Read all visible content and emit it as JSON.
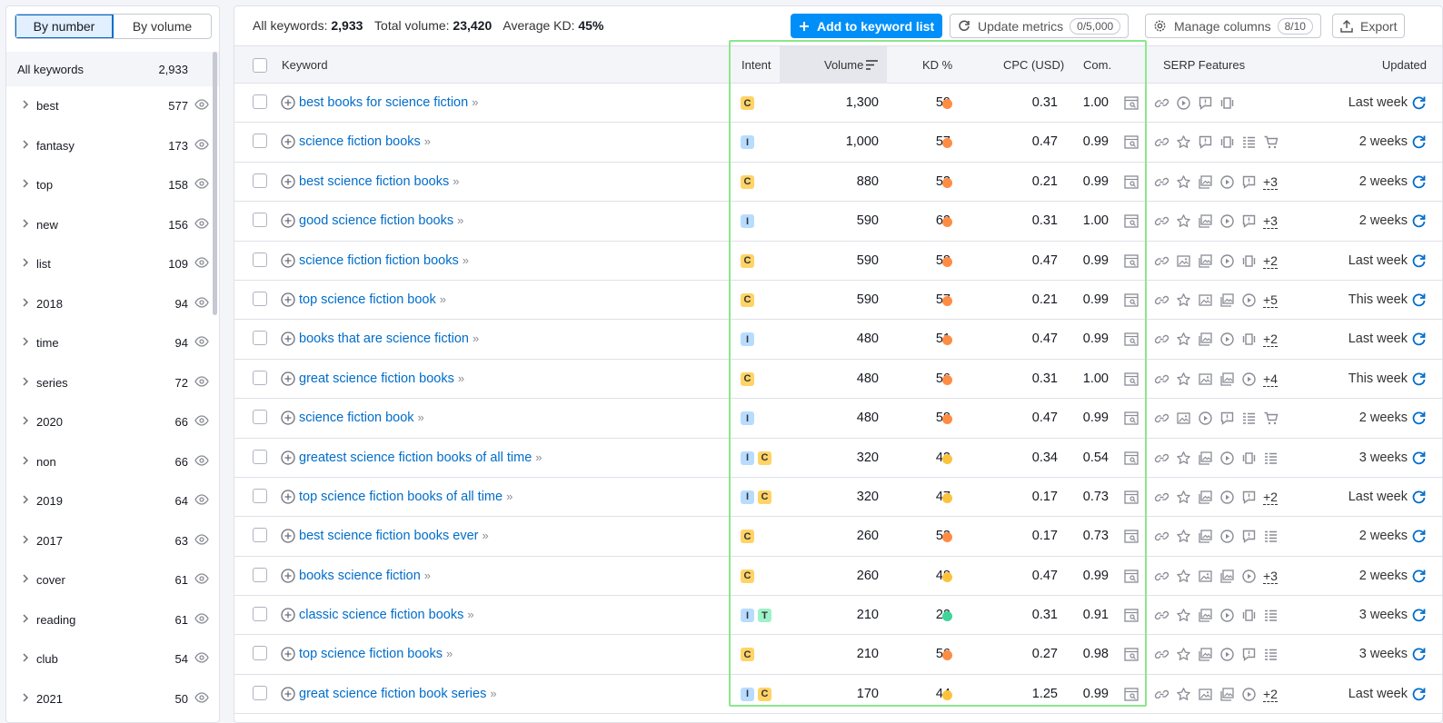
{
  "sidebar": {
    "toggle": [
      "By number",
      "By volume"
    ],
    "all_label": "All keywords",
    "all_count": "2,933",
    "items": [
      {
        "label": "best",
        "count": "577"
      },
      {
        "label": "fantasy",
        "count": "173"
      },
      {
        "label": "top",
        "count": "158"
      },
      {
        "label": "new",
        "count": "156"
      },
      {
        "label": "list",
        "count": "109"
      },
      {
        "label": "2018",
        "count": "94"
      },
      {
        "label": "time",
        "count": "94"
      },
      {
        "label": "series",
        "count": "72"
      },
      {
        "label": "2020",
        "count": "66"
      },
      {
        "label": "non",
        "count": "66"
      },
      {
        "label": "2019",
        "count": "64"
      },
      {
        "label": "2017",
        "count": "63"
      },
      {
        "label": "cover",
        "count": "61"
      },
      {
        "label": "reading",
        "count": "61"
      },
      {
        "label": "club",
        "count": "54"
      },
      {
        "label": "2021",
        "count": "50"
      }
    ]
  },
  "stats": {
    "all_label": "All keywords:",
    "all_value": "2,933",
    "volume_label": "Total volume:",
    "volume_value": "23,420",
    "kd_label": "Average KD:",
    "kd_value": "45%"
  },
  "toolbar": {
    "add_label": "Add to keyword list",
    "update_label": "Update metrics",
    "update_badge": "0/5,000",
    "columns_label": "Manage columns",
    "columns_badge": "8/10",
    "export_label": "Export"
  },
  "columns": {
    "keyword": "Keyword",
    "intent": "Intent",
    "volume": "Volume",
    "kd": "KD %",
    "cpc": "CPC (USD)",
    "com": "Com.",
    "serp": "SERP Features",
    "updated": "Updated"
  },
  "colors": {
    "hard": "#ff8c43",
    "medium": "#fdc23c",
    "easy": "#3fd49a",
    "link": "#006dca",
    "highlight": "#8be78b"
  },
  "rows": [
    {
      "keyword": "best books for science fiction",
      "intent": [
        "C"
      ],
      "volume": "1,300",
      "kd": "59",
      "kd_level": "hard",
      "cpc": "0.31",
      "com": "1.00",
      "features": [
        "link-icon",
        "video-icon",
        "review-icon",
        "carousel-icon"
      ],
      "more": "",
      "updated": "Last week"
    },
    {
      "keyword": "science fiction books",
      "intent": [
        "I"
      ],
      "volume": "1,000",
      "kd": "57",
      "kd_level": "hard",
      "cpc": "0.47",
      "com": "0.99",
      "features": [
        "link-icon",
        "star-icon",
        "review-icon",
        "carousel-icon",
        "list-icon",
        "cart-icon"
      ],
      "more": "",
      "updated": "2 weeks"
    },
    {
      "keyword": "best science fiction books",
      "intent": [
        "C"
      ],
      "volume": "880",
      "kd": "53",
      "kd_level": "hard",
      "cpc": "0.21",
      "com": "0.99",
      "features": [
        "link-icon",
        "star-icon",
        "images-icon",
        "video-icon",
        "review-icon"
      ],
      "more": "+3",
      "updated": "2 weeks"
    },
    {
      "keyword": "good science fiction books",
      "intent": [
        "I"
      ],
      "volume": "590",
      "kd": "62",
      "kd_level": "hard",
      "cpc": "0.31",
      "com": "1.00",
      "features": [
        "link-icon",
        "star-icon",
        "images-icon",
        "video-icon",
        "review-icon"
      ],
      "more": "+3",
      "updated": "2 weeks"
    },
    {
      "keyword": "science fiction fiction books",
      "intent": [
        "C"
      ],
      "volume": "590",
      "kd": "58",
      "kd_level": "hard",
      "cpc": "0.47",
      "com": "0.99",
      "features": [
        "link-icon",
        "image-icon",
        "images-icon",
        "video-icon",
        "carousel-icon"
      ],
      "more": "+2",
      "updated": "Last week"
    },
    {
      "keyword": "top science fiction book",
      "intent": [
        "C"
      ],
      "volume": "590",
      "kd": "57",
      "kd_level": "hard",
      "cpc": "0.21",
      "com": "0.99",
      "features": [
        "link-icon",
        "star-icon",
        "image-icon",
        "images-icon",
        "video-icon"
      ],
      "more": "+5",
      "updated": "This week"
    },
    {
      "keyword": "books that are science fiction",
      "intent": [
        "I"
      ],
      "volume": "480",
      "kd": "51",
      "kd_level": "hard",
      "cpc": "0.47",
      "com": "0.99",
      "features": [
        "link-icon",
        "star-icon",
        "images-icon",
        "video-icon",
        "carousel-icon"
      ],
      "more": "+2",
      "updated": "Last week"
    },
    {
      "keyword": "great science fiction books",
      "intent": [
        "C"
      ],
      "volume": "480",
      "kd": "56",
      "kd_level": "hard",
      "cpc": "0.31",
      "com": "1.00",
      "features": [
        "link-icon",
        "star-icon",
        "image-icon",
        "images-icon",
        "video-icon"
      ],
      "more": "+4",
      "updated": "This week"
    },
    {
      "keyword": "science fiction book",
      "intent": [
        "I"
      ],
      "volume": "480",
      "kd": "58",
      "kd_level": "hard",
      "cpc": "0.47",
      "com": "0.99",
      "features": [
        "link-icon",
        "image-icon",
        "video-icon",
        "review-icon",
        "list-icon",
        "cart-icon"
      ],
      "more": "",
      "updated": "2 weeks"
    },
    {
      "keyword": "greatest science fiction books of all time",
      "intent": [
        "I",
        "C"
      ],
      "volume": "320",
      "kd": "43",
      "kd_level": "medium",
      "cpc": "0.34",
      "com": "0.54",
      "features": [
        "link-icon",
        "star-icon",
        "images-icon",
        "video-icon",
        "carousel-icon",
        "list-icon"
      ],
      "more": "",
      "updated": "3 weeks"
    },
    {
      "keyword": "top science fiction books of all time",
      "intent": [
        "I",
        "C"
      ],
      "volume": "320",
      "kd": "47",
      "kd_level": "medium",
      "cpc": "0.17",
      "com": "0.73",
      "features": [
        "link-icon",
        "star-icon",
        "images-icon",
        "video-icon",
        "review-icon"
      ],
      "more": "+2",
      "updated": "Last week"
    },
    {
      "keyword": "best science fiction books ever",
      "intent": [
        "C"
      ],
      "volume": "260",
      "kd": "53",
      "kd_level": "hard",
      "cpc": "0.17",
      "com": "0.73",
      "features": [
        "link-icon",
        "star-icon",
        "images-icon",
        "video-icon",
        "review-icon",
        "list-icon"
      ],
      "more": "",
      "updated": "2 weeks"
    },
    {
      "keyword": "books science fiction",
      "intent": [
        "C"
      ],
      "volume": "260",
      "kd": "48",
      "kd_level": "medium",
      "cpc": "0.47",
      "com": "0.99",
      "features": [
        "link-icon",
        "star-icon",
        "image-icon",
        "images-icon",
        "video-icon"
      ],
      "more": "+3",
      "updated": "2 weeks"
    },
    {
      "keyword": "classic science fiction books",
      "intent": [
        "I",
        "T"
      ],
      "volume": "210",
      "kd": "22",
      "kd_level": "easy",
      "cpc": "0.31",
      "com": "0.91",
      "features": [
        "link-icon",
        "star-icon",
        "images-icon",
        "video-icon",
        "carousel-icon",
        "list-icon"
      ],
      "more": "",
      "updated": "3 weeks"
    },
    {
      "keyword": "top science fiction books",
      "intent": [
        "C"
      ],
      "volume": "210",
      "kd": "56",
      "kd_level": "hard",
      "cpc": "0.27",
      "com": "0.98",
      "features": [
        "link-icon",
        "star-icon",
        "images-icon",
        "video-icon",
        "review-icon",
        "list-icon"
      ],
      "more": "",
      "updated": "3 weeks"
    },
    {
      "keyword": "great science fiction book series",
      "intent": [
        "I",
        "C"
      ],
      "volume": "170",
      "kd": "44",
      "kd_level": "medium",
      "cpc": "1.25",
      "com": "0.99",
      "features": [
        "link-icon",
        "star-icon",
        "image-icon",
        "images-icon",
        "video-icon"
      ],
      "more": "+2",
      "updated": "Last week"
    }
  ]
}
